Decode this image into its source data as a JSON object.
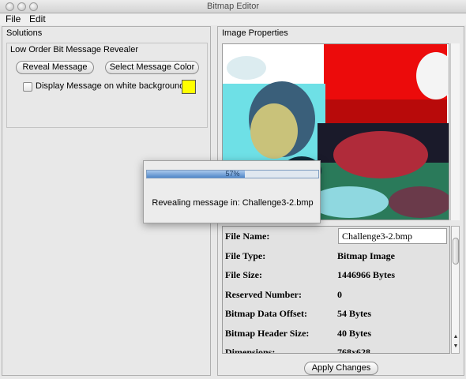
{
  "window": {
    "title": "Bitmap Editor"
  },
  "menu": [
    "File",
    "Edit"
  ],
  "solutions": {
    "title": "Solutions",
    "group_title": "Low Order Bit Message Revealer",
    "reveal_button": "Reveal Message",
    "color_button": "Select Message Color",
    "checkbox_label": "Display Message on white background",
    "checkbox_checked": false,
    "message_color": "#ffff00"
  },
  "image_properties": {
    "title": "Image Properties",
    "rows": [
      {
        "label": "File Name:",
        "value": "Challenge3-2.bmp",
        "editable": true
      },
      {
        "label": "File Type:",
        "value": "Bitmap Image"
      },
      {
        "label": "File Size:",
        "value": "1446966 Bytes"
      },
      {
        "label": "Reserved Number:",
        "value": "0"
      },
      {
        "label": "Bitmap Data Offset:",
        "value": "54 Bytes"
      },
      {
        "label": "Bitmap Header Size:",
        "value": "40 Bytes"
      },
      {
        "label": "Dimensions:",
        "value": "768x628"
      }
    ],
    "apply_button": "Apply Changes"
  },
  "progress": {
    "percent": 57,
    "percent_label": "57%",
    "message": "Revealing message in: Challenge3-2.bmp",
    "accent": "#4f86c8"
  },
  "icons": [
    "window-close-icon",
    "window-minimize-icon",
    "window-zoom-icon",
    "scroll-up-icon",
    "scroll-down-icon"
  ]
}
